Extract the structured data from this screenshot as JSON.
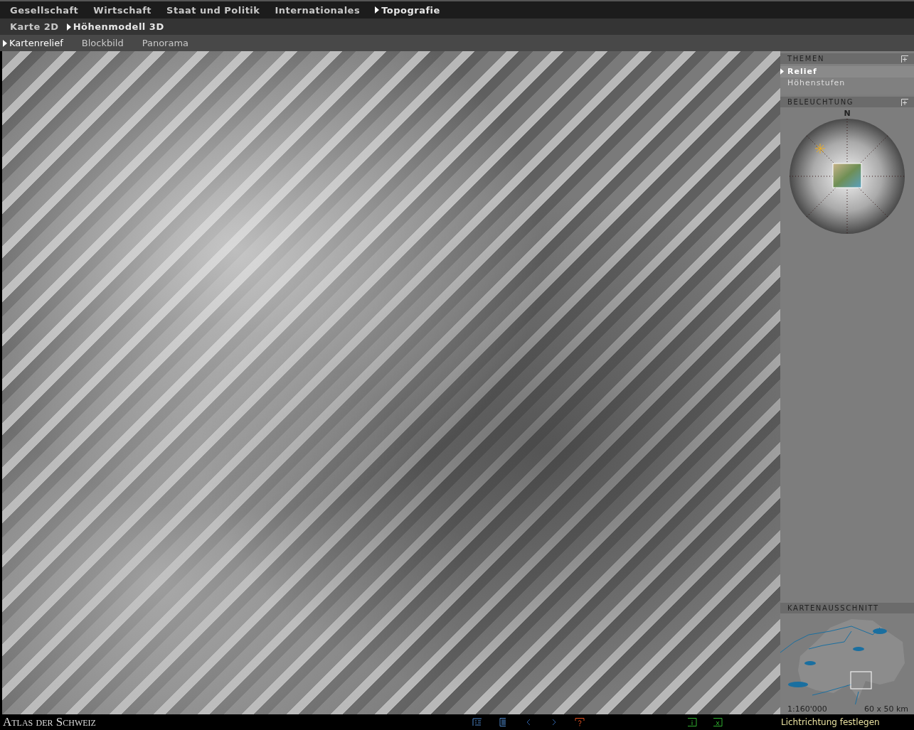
{
  "menu_primary": [
    {
      "label": "Gesellschaft",
      "selected": false
    },
    {
      "label": "Wirtschaft",
      "selected": false
    },
    {
      "label": "Staat und Politik",
      "selected": false
    },
    {
      "label": "Internationales",
      "selected": false
    },
    {
      "label": "Topografie",
      "selected": true
    }
  ],
  "menu_secondary": [
    {
      "label": "Karte 2D",
      "selected": false
    },
    {
      "label": "Höhenmodell 3D",
      "selected": true
    }
  ],
  "menu_tertiary": [
    {
      "label": "Kartenrelief",
      "selected": true
    },
    {
      "label": "Blockbild",
      "selected": false
    },
    {
      "label": "Panorama",
      "selected": false
    }
  ],
  "sidebar": {
    "themen": {
      "title": "THEMEN",
      "items": [
        {
          "label": "Relief",
          "selected": true
        },
        {
          "label": "Höhenstufen",
          "selected": false
        }
      ]
    },
    "beleuchtung": {
      "title": "BELEUCHTUNG",
      "compass_label": "N"
    },
    "kartenausschnitt": {
      "title": "KARTENAUSSCHNITT",
      "scale": "1:160'000",
      "extent": "60 x 50 km"
    }
  },
  "footer": {
    "logo": "Atlas der Schweiz",
    "status": "Lichtrichtung festlegen"
  }
}
